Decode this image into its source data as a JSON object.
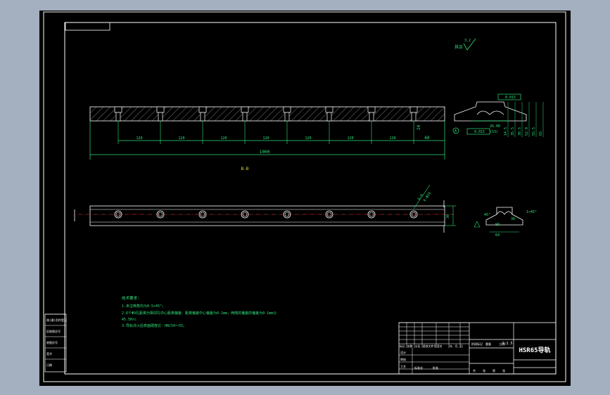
{
  "drawing": {
    "title": "HSR65导轨",
    "scale": "1:2.5",
    "section_label": "B-B",
    "surface_symbol_text": "其余",
    "roughness_value": "3.2",
    "tolerance_frame_1": "0.015",
    "tolerance_frame_2": "0.015",
    "datum_letter": "A"
  },
  "dimensions": {
    "hole_spacing": [
      "120",
      "120",
      "120",
      "120",
      "120",
      "120",
      "120"
    ],
    "end_offset": "60",
    "rail_depth": "24",
    "total_length": "1000",
    "profile_width_bottom": "(53)",
    "profile_width_top": "26.00",
    "profile_heights": [
      "14.5",
      "35.5",
      "38.5",
      "52.0",
      "55.5",
      "65"
    ],
    "plan_width": "30",
    "plan_callout": "6-9",
    "plan_callout_2": "6-Φ20",
    "end_view_dims": [
      "90",
      "64",
      "30",
      "1×45°"
    ],
    "end_view_angle": "45°"
  },
  "tech_notes": {
    "heading": "技术要求：",
    "lines": [
      "1.未注倒角均为0.5×45°；",
      "2.6个Φ9孔距离为相邻孔中心距离偏差：距离偏差中心偏差为0.1mm，两侧的偏差的偏差为0.1mm公",
      "45.5Hrc",
      "3.导轨淬火后表面硬度达：HRC50～55。"
    ]
  },
  "title_block": {
    "row_labels": [
      "标记",
      "处数",
      "分区",
      "更改文件号",
      "签名",
      "年、月、日"
    ],
    "left_labels": [
      "设计",
      "审核",
      "工艺"
    ],
    "mid_labels": [
      "标准化",
      "批准"
    ],
    "right_labels": [
      "阶段标记",
      "重量",
      "比例"
    ],
    "bottom_labels": [
      "共",
      "张",
      "第",
      "张"
    ]
  },
  "side_table": [
    "借(通)用件登记",
    "旧底图总号",
    "底图总号",
    "签字",
    "日期"
  ]
}
